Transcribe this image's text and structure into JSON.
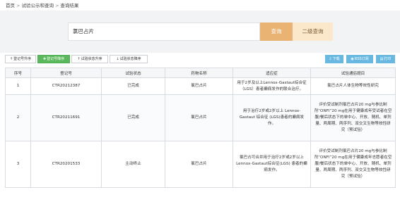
{
  "breadcrumb": {
    "home": "首页",
    "section": "试验公示和查询",
    "current": "查询结果",
    "separator": ">"
  },
  "search": {
    "query": "氯巴占片",
    "search_label": "查询",
    "advanced_label": "二级查询"
  },
  "sort_buttons": [
    {
      "label": "登记号升序",
      "icon": "↑",
      "active": false
    },
    {
      "label": "登记号降序",
      "icon": "✚",
      "active": true
    },
    {
      "label": "试验状态升序",
      "icon": "↑",
      "active": false
    },
    {
      "label": "试验状态降序",
      "icon": "↓",
      "active": false
    }
  ],
  "tools": [
    {
      "label": "下载",
      "icon": "⇩"
    },
    {
      "label": "RSS订阅",
      "icon": "◉"
    },
    {
      "label": "打印",
      "icon": "▤"
    }
  ],
  "table": {
    "columns": [
      "序号",
      "登记号",
      "试验状态",
      "药物名称",
      "适应症",
      "试验通俗题目"
    ],
    "rows": [
      {
        "no": "1",
        "reg": "CTR20212387",
        "status": "已完成",
        "drug": "氯巴占片",
        "indication": "用于2岁及以上Lennox-Gastaut综合征（LGS）患者癫痫发作的联合治疗。",
        "title": "氯巴占片人体生物等效性研究"
      },
      {
        "no": "2",
        "reg": "CTR20211691",
        "status": "已完成",
        "drug": "氯巴占片",
        "indication": "用于治疗2岁或2岁以上 Lennox-Gastaut 综合征 (LGS)患者的癫痫发作。",
        "title": "评价受试制剂氯巴占片20 mg与参比制剂“ONFI”20 mg在用于健康成年受试者在空腹/餐后状态下的单中心、开放、随机、单剂量、两周期、两序列、双交叉生物等效性研究（预试验）"
      },
      {
        "no": "3",
        "reg": "CTR20201533",
        "status": "主动终止",
        "drug": "氯巴占片",
        "indication": "氯巴占可合并用于治疗2岁或2岁以上Lennox-Gastaut综合征(LGS) 患者的癫痫发作。",
        "title": "评价受试制剂氯巴占片20 mg与参比制剂“ONFI”20 mg在用于健康成年志愿者在空腹/餐后状态下的单中心、开放、随机、单剂量、两周期、两序列、双交叉生物等效性研究（预试验）"
      }
    ]
  }
}
